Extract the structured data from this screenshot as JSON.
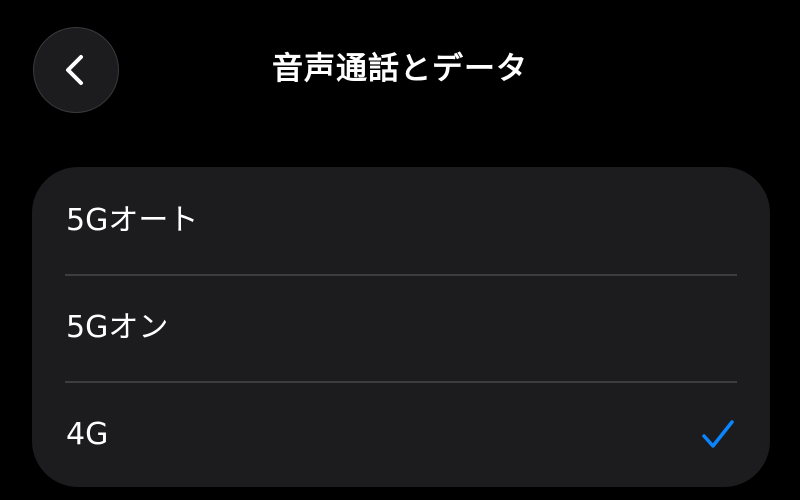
{
  "header": {
    "back_icon": "chevron-left-icon",
    "title": "音声通話とデータ"
  },
  "options": {
    "items": [
      {
        "label": "5Gオート",
        "selected": false
      },
      {
        "label": "5Gオン",
        "selected": false
      },
      {
        "label": "4G",
        "selected": true
      }
    ],
    "check_icon": "checkmark-icon"
  },
  "colors": {
    "background": "#000000",
    "group_background": "#1c1c1e",
    "accent": "#0a84ff",
    "separator": "#3d3d40"
  }
}
